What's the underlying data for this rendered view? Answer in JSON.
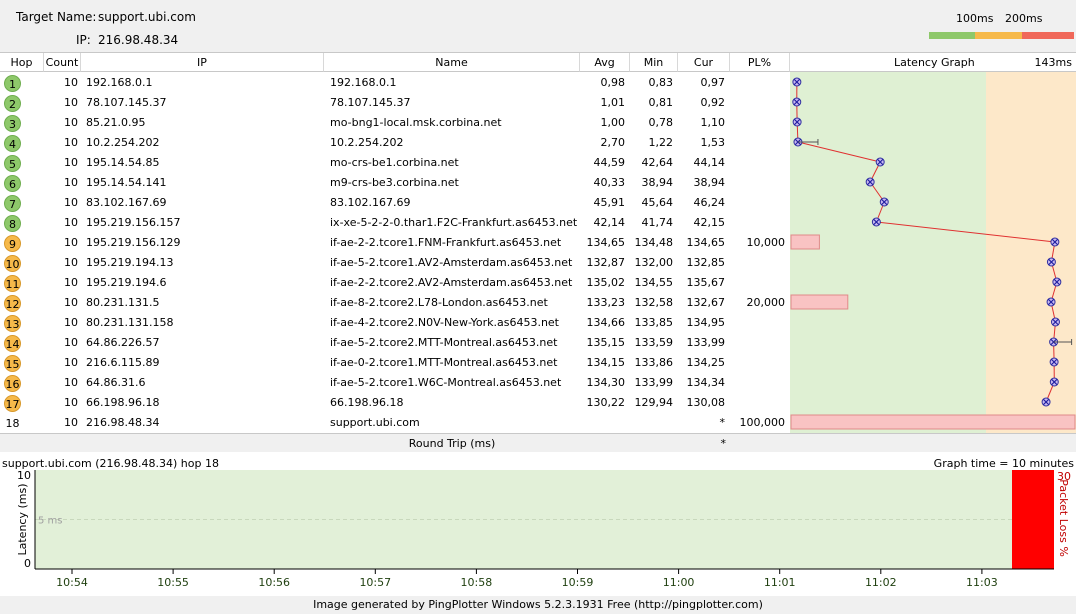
{
  "header": {
    "target_label": "Target Name:",
    "target_value": "support.ubi.com",
    "ip_label": "IP:",
    "ip_value": "216.98.48.34"
  },
  "legend": {
    "label_100": "100ms",
    "label_200": "200ms",
    "colors": {
      "good": "#8ec86a",
      "warn": "#f6b94a",
      "bad": "#f0685a"
    }
  },
  "columns": {
    "hop": "Hop",
    "count": "Count",
    "ip": "IP",
    "name": "Name",
    "avg": "Avg",
    "min": "Min",
    "cur": "Cur",
    "pl": "PL%",
    "graph": "Latency Graph",
    "graph_max": "143ms"
  },
  "hops": [
    {
      "hop": "1",
      "count": "10",
      "ip": "192.168.0.1",
      "name": "192.168.0.1",
      "avg": "0,98",
      "min": "0,83",
      "cur": "0,97",
      "pl": "",
      "status": "green",
      "lat": 0.97,
      "plv": 0
    },
    {
      "hop": "2",
      "count": "10",
      "ip": "78.107.145.37",
      "name": "78.107.145.37",
      "avg": "1,01",
      "min": "0,81",
      "cur": "0,92",
      "pl": "",
      "status": "green",
      "lat": 0.92,
      "plv": 0
    },
    {
      "hop": "3",
      "count": "10",
      "ip": "85.21.0.95",
      "name": "mo-bng1-local.msk.corbina.net",
      "avg": "1,00",
      "min": "0,78",
      "cur": "1,10",
      "pl": "",
      "status": "green",
      "lat": 1.1,
      "plv": 0
    },
    {
      "hop": "4",
      "count": "10",
      "ip": "10.2.254.202",
      "name": "10.2.254.202",
      "avg": "2,70",
      "min": "1,22",
      "cur": "1,53",
      "pl": "",
      "status": "green",
      "lat": 1.53,
      "plv": 0
    },
    {
      "hop": "5",
      "count": "10",
      "ip": "195.14.54.85",
      "name": "mo-crs-be1.corbina.net",
      "avg": "44,59",
      "min": "42,64",
      "cur": "44,14",
      "pl": "",
      "status": "green",
      "lat": 44.14,
      "plv": 0
    },
    {
      "hop": "6",
      "count": "10",
      "ip": "195.14.54.141",
      "name": "m9-crs-be3.corbina.net",
      "avg": "40,33",
      "min": "38,94",
      "cur": "38,94",
      "pl": "",
      "status": "green",
      "lat": 38.94,
      "plv": 0
    },
    {
      "hop": "7",
      "count": "10",
      "ip": "83.102.167.69",
      "name": "83.102.167.69",
      "avg": "45,91",
      "min": "45,64",
      "cur": "46,24",
      "pl": "",
      "status": "green",
      "lat": 46.24,
      "plv": 0
    },
    {
      "hop": "8",
      "count": "10",
      "ip": "195.219.156.157",
      "name": "ix-xe-5-2-2-0.thar1.F2C-Frankfurt.as6453.net",
      "avg": "42,14",
      "min": "41,74",
      "cur": "42,15",
      "pl": "",
      "status": "green",
      "lat": 42.15,
      "plv": 0
    },
    {
      "hop": "9",
      "count": "10",
      "ip": "195.219.156.129",
      "name": "if-ae-2-2.tcore1.FNM-Frankfurt.as6453.net",
      "avg": "134,65",
      "min": "134,48",
      "cur": "134,65",
      "pl": "10,000",
      "status": "orange",
      "lat": 134.65,
      "plv": 10
    },
    {
      "hop": "10",
      "count": "10",
      "ip": "195.219.194.13",
      "name": "if-ae-5-2.tcore1.AV2-Amsterdam.as6453.net",
      "avg": "132,87",
      "min": "132,00",
      "cur": "132,85",
      "pl": "",
      "status": "orange",
      "lat": 132.85,
      "plv": 0
    },
    {
      "hop": "11",
      "count": "10",
      "ip": "195.219.194.6",
      "name": "if-ae-2-2.tcore2.AV2-Amsterdam.as6453.net",
      "avg": "135,02",
      "min": "134,55",
      "cur": "135,67",
      "pl": "",
      "status": "orange",
      "lat": 135.67,
      "plv": 0
    },
    {
      "hop": "12",
      "count": "10",
      "ip": "80.231.131.5",
      "name": "if-ae-8-2.tcore2.L78-London.as6453.net",
      "avg": "133,23",
      "min": "132,58",
      "cur": "132,67",
      "pl": "20,000",
      "status": "orange",
      "lat": 132.67,
      "plv": 20
    },
    {
      "hop": "13",
      "count": "10",
      "ip": "80.231.131.158",
      "name": "if-ae-4-2.tcore2.N0V-New-York.as6453.net",
      "avg": "134,66",
      "min": "133,85",
      "cur": "134,95",
      "pl": "",
      "status": "orange",
      "lat": 134.95,
      "plv": 0
    },
    {
      "hop": "14",
      "count": "10",
      "ip": "64.86.226.57",
      "name": "if-ae-5-2.tcore2.MTT-Montreal.as6453.net",
      "avg": "135,15",
      "min": "133,59",
      "cur": "133,99",
      "pl": "",
      "status": "orange",
      "lat": 133.99,
      "plv": 0
    },
    {
      "hop": "15",
      "count": "10",
      "ip": "216.6.115.89",
      "name": "if-ae-0-2.tcore1.MTT-Montreal.as6453.net",
      "avg": "134,15",
      "min": "133,86",
      "cur": "134,25",
      "pl": "",
      "status": "orange",
      "lat": 134.25,
      "plv": 0
    },
    {
      "hop": "16",
      "count": "10",
      "ip": "64.86.31.6",
      "name": "if-ae-5-2.tcore1.W6C-Montreal.as6453.net",
      "avg": "134,30",
      "min": "133,99",
      "cur": "134,34",
      "pl": "",
      "status": "orange",
      "lat": 134.34,
      "plv": 0
    },
    {
      "hop": "17",
      "count": "10",
      "ip": "66.198.96.18",
      "name": "66.198.96.18",
      "avg": "130,22",
      "min": "129,94",
      "cur": "130,08",
      "pl": "",
      "status": "orange",
      "lat": 130.08,
      "plv": 0
    },
    {
      "hop": "18",
      "count": "10",
      "ip": "216.98.48.34",
      "name": "support.ubi.com",
      "avg": "",
      "min": "",
      "cur": "*",
      "pl": "100,000",
      "status": "none",
      "lat": null,
      "plv": 100
    }
  ],
  "round_trip": {
    "label": "Round Trip (ms)",
    "value": "*"
  },
  "timeline": {
    "title": "support.ubi.com (216.98.48.34) hop 18",
    "graph_time": "Graph time = 10 minutes",
    "y_label": "Latency (ms)",
    "y_ticks": [
      "10",
      "5",
      "0"
    ],
    "mid_label": "5 ms",
    "pl_label": "Packet Loss %",
    "pl_max": "30",
    "x_ticks": [
      "10:54",
      "10:55",
      "10:56",
      "10:57",
      "10:58",
      "10:59",
      "11:00",
      "11:01",
      "11:02",
      "11:03"
    ]
  },
  "footer": "Image generated by PingPlotter Windows 5.2.3.1931 Free (http://pingplotter.com)",
  "chart_data": {
    "type": "line",
    "title": "Latency Graph",
    "xlabel": "",
    "ylabel": "",
    "xlim": [
      0,
      143
    ],
    "categories": [
      "1",
      "2",
      "3",
      "4",
      "5",
      "6",
      "7",
      "8",
      "9",
      "10",
      "11",
      "12",
      "13",
      "14",
      "15",
      "16",
      "17",
      "18"
    ],
    "series": [
      {
        "name": "Cur",
        "values": [
          0.97,
          0.92,
          1.1,
          1.53,
          44.14,
          38.94,
          46.24,
          42.15,
          134.65,
          132.85,
          135.67,
          132.67,
          134.95,
          133.99,
          134.25,
          134.34,
          130.08,
          null
        ]
      },
      {
        "name": "PL%",
        "values": [
          0,
          0,
          0,
          0,
          0,
          0,
          0,
          0,
          10,
          0,
          0,
          20,
          0,
          0,
          0,
          0,
          0,
          100
        ]
      }
    ]
  }
}
